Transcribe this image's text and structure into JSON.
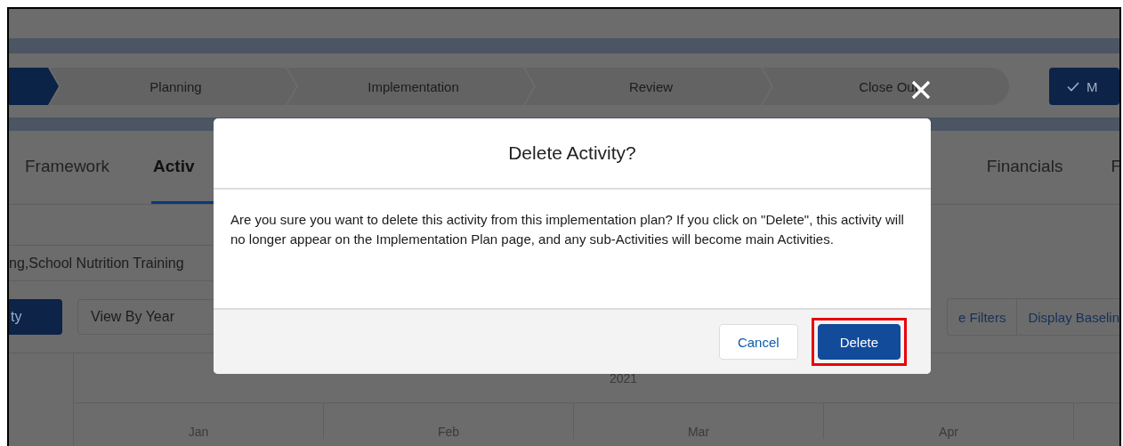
{
  "path": {
    "stages": [
      {
        "complete": true
      },
      {
        "label": "Planning",
        "complete": false
      },
      {
        "label": "Implementation",
        "complete": false
      },
      {
        "label": "Review",
        "complete": false
      },
      {
        "label": "Close Out",
        "complete": false
      }
    ],
    "mark_button": {
      "label": "M"
    }
  },
  "tabs": [
    {
      "label": "Framework",
      "selected": false
    },
    {
      "label": "Activ",
      "selected": true
    },
    {
      "label": "Financials",
      "selected": false
    },
    {
      "label": "F",
      "selected": false
    }
  ],
  "field_value": "ng,School Nutrition Training",
  "toolbar": {
    "primary_button": "ty",
    "view_select": "View By Year",
    "filters_button": "e Filters",
    "baseline_button": "Display Baselin"
  },
  "timeline": {
    "year": "2021",
    "months": [
      "Jan",
      "Feb",
      "Mar",
      "Apr"
    ]
  },
  "modal": {
    "title": "Delete Activity?",
    "message": "Are you sure you want to delete this activity from this implementation plan? If you click on \"Delete\", this activity will no longer appear on the Implementation Plan page, and any sub-Activities will become main Activities.",
    "buttons": [
      {
        "label": "Cancel",
        "kind": "neutral",
        "highlighted": false
      },
      {
        "label": "Delete",
        "kind": "brand",
        "highlighted": true
      }
    ]
  }
}
